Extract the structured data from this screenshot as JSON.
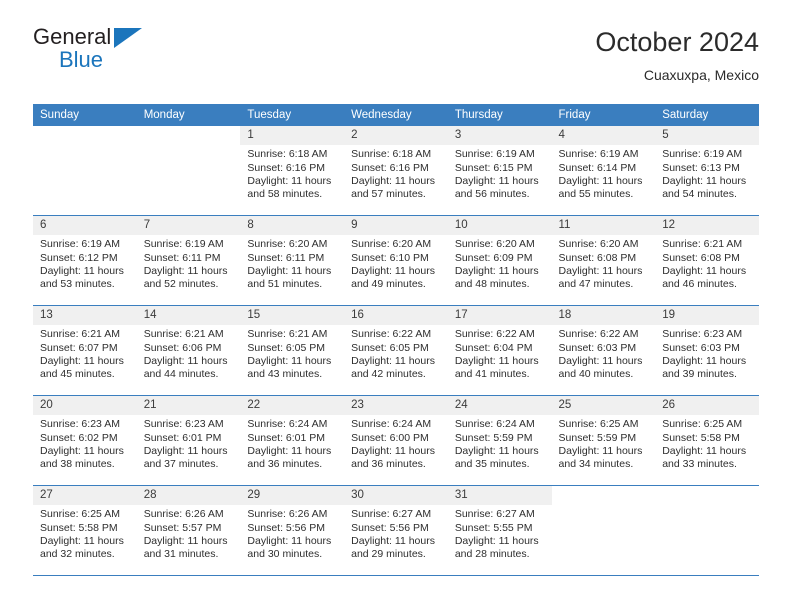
{
  "logo": {
    "word1": "General",
    "word2": "Blue",
    "accent": "#1b75bc",
    "triangle_icon": "triangle-icon"
  },
  "header": {
    "title": "October 2024",
    "location": "Cuaxuxpa, Mexico",
    "header_bg": "#3a7ebf"
  },
  "weekdays": [
    "Sunday",
    "Monday",
    "Tuesday",
    "Wednesday",
    "Thursday",
    "Friday",
    "Saturday"
  ],
  "labels": {
    "sunrise": "Sunrise:",
    "sunset": "Sunset:",
    "daylight": "Daylight:"
  },
  "weeks": [
    [
      {
        "day": "",
        "sunrise": "",
        "sunset": "",
        "daylight_l1": "",
        "daylight_l2": ""
      },
      {
        "day": "",
        "sunrise": "",
        "sunset": "",
        "daylight_l1": "",
        "daylight_l2": ""
      },
      {
        "day": "1",
        "sunrise": "Sunrise: 6:18 AM",
        "sunset": "Sunset: 6:16 PM",
        "daylight_l1": "Daylight: 11 hours",
        "daylight_l2": "and 58 minutes."
      },
      {
        "day": "2",
        "sunrise": "Sunrise: 6:18 AM",
        "sunset": "Sunset: 6:16 PM",
        "daylight_l1": "Daylight: 11 hours",
        "daylight_l2": "and 57 minutes."
      },
      {
        "day": "3",
        "sunrise": "Sunrise: 6:19 AM",
        "sunset": "Sunset: 6:15 PM",
        "daylight_l1": "Daylight: 11 hours",
        "daylight_l2": "and 56 minutes."
      },
      {
        "day": "4",
        "sunrise": "Sunrise: 6:19 AM",
        "sunset": "Sunset: 6:14 PM",
        "daylight_l1": "Daylight: 11 hours",
        "daylight_l2": "and 55 minutes."
      },
      {
        "day": "5",
        "sunrise": "Sunrise: 6:19 AM",
        "sunset": "Sunset: 6:13 PM",
        "daylight_l1": "Daylight: 11 hours",
        "daylight_l2": "and 54 minutes."
      }
    ],
    [
      {
        "day": "6",
        "sunrise": "Sunrise: 6:19 AM",
        "sunset": "Sunset: 6:12 PM",
        "daylight_l1": "Daylight: 11 hours",
        "daylight_l2": "and 53 minutes."
      },
      {
        "day": "7",
        "sunrise": "Sunrise: 6:19 AM",
        "sunset": "Sunset: 6:11 PM",
        "daylight_l1": "Daylight: 11 hours",
        "daylight_l2": "and 52 minutes."
      },
      {
        "day": "8",
        "sunrise": "Sunrise: 6:20 AM",
        "sunset": "Sunset: 6:11 PM",
        "daylight_l1": "Daylight: 11 hours",
        "daylight_l2": "and 51 minutes."
      },
      {
        "day": "9",
        "sunrise": "Sunrise: 6:20 AM",
        "sunset": "Sunset: 6:10 PM",
        "daylight_l1": "Daylight: 11 hours",
        "daylight_l2": "and 49 minutes."
      },
      {
        "day": "10",
        "sunrise": "Sunrise: 6:20 AM",
        "sunset": "Sunset: 6:09 PM",
        "daylight_l1": "Daylight: 11 hours",
        "daylight_l2": "and 48 minutes."
      },
      {
        "day": "11",
        "sunrise": "Sunrise: 6:20 AM",
        "sunset": "Sunset: 6:08 PM",
        "daylight_l1": "Daylight: 11 hours",
        "daylight_l2": "and 47 minutes."
      },
      {
        "day": "12",
        "sunrise": "Sunrise: 6:21 AM",
        "sunset": "Sunset: 6:08 PM",
        "daylight_l1": "Daylight: 11 hours",
        "daylight_l2": "and 46 minutes."
      }
    ],
    [
      {
        "day": "13",
        "sunrise": "Sunrise: 6:21 AM",
        "sunset": "Sunset: 6:07 PM",
        "daylight_l1": "Daylight: 11 hours",
        "daylight_l2": "and 45 minutes."
      },
      {
        "day": "14",
        "sunrise": "Sunrise: 6:21 AM",
        "sunset": "Sunset: 6:06 PM",
        "daylight_l1": "Daylight: 11 hours",
        "daylight_l2": "and 44 minutes."
      },
      {
        "day": "15",
        "sunrise": "Sunrise: 6:21 AM",
        "sunset": "Sunset: 6:05 PM",
        "daylight_l1": "Daylight: 11 hours",
        "daylight_l2": "and 43 minutes."
      },
      {
        "day": "16",
        "sunrise": "Sunrise: 6:22 AM",
        "sunset": "Sunset: 6:05 PM",
        "daylight_l1": "Daylight: 11 hours",
        "daylight_l2": "and 42 minutes."
      },
      {
        "day": "17",
        "sunrise": "Sunrise: 6:22 AM",
        "sunset": "Sunset: 6:04 PM",
        "daylight_l1": "Daylight: 11 hours",
        "daylight_l2": "and 41 minutes."
      },
      {
        "day": "18",
        "sunrise": "Sunrise: 6:22 AM",
        "sunset": "Sunset: 6:03 PM",
        "daylight_l1": "Daylight: 11 hours",
        "daylight_l2": "and 40 minutes."
      },
      {
        "day": "19",
        "sunrise": "Sunrise: 6:23 AM",
        "sunset": "Sunset: 6:03 PM",
        "daylight_l1": "Daylight: 11 hours",
        "daylight_l2": "and 39 minutes."
      }
    ],
    [
      {
        "day": "20",
        "sunrise": "Sunrise: 6:23 AM",
        "sunset": "Sunset: 6:02 PM",
        "daylight_l1": "Daylight: 11 hours",
        "daylight_l2": "and 38 minutes."
      },
      {
        "day": "21",
        "sunrise": "Sunrise: 6:23 AM",
        "sunset": "Sunset: 6:01 PM",
        "daylight_l1": "Daylight: 11 hours",
        "daylight_l2": "and 37 minutes."
      },
      {
        "day": "22",
        "sunrise": "Sunrise: 6:24 AM",
        "sunset": "Sunset: 6:01 PM",
        "daylight_l1": "Daylight: 11 hours",
        "daylight_l2": "and 36 minutes."
      },
      {
        "day": "23",
        "sunrise": "Sunrise: 6:24 AM",
        "sunset": "Sunset: 6:00 PM",
        "daylight_l1": "Daylight: 11 hours",
        "daylight_l2": "and 36 minutes."
      },
      {
        "day": "24",
        "sunrise": "Sunrise: 6:24 AM",
        "sunset": "Sunset: 5:59 PM",
        "daylight_l1": "Daylight: 11 hours",
        "daylight_l2": "and 35 minutes."
      },
      {
        "day": "25",
        "sunrise": "Sunrise: 6:25 AM",
        "sunset": "Sunset: 5:59 PM",
        "daylight_l1": "Daylight: 11 hours",
        "daylight_l2": "and 34 minutes."
      },
      {
        "day": "26",
        "sunrise": "Sunrise: 6:25 AM",
        "sunset": "Sunset: 5:58 PM",
        "daylight_l1": "Daylight: 11 hours",
        "daylight_l2": "and 33 minutes."
      }
    ],
    [
      {
        "day": "27",
        "sunrise": "Sunrise: 6:25 AM",
        "sunset": "Sunset: 5:58 PM",
        "daylight_l1": "Daylight: 11 hours",
        "daylight_l2": "and 32 minutes."
      },
      {
        "day": "28",
        "sunrise": "Sunrise: 6:26 AM",
        "sunset": "Sunset: 5:57 PM",
        "daylight_l1": "Daylight: 11 hours",
        "daylight_l2": "and 31 minutes."
      },
      {
        "day": "29",
        "sunrise": "Sunrise: 6:26 AM",
        "sunset": "Sunset: 5:56 PM",
        "daylight_l1": "Daylight: 11 hours",
        "daylight_l2": "and 30 minutes."
      },
      {
        "day": "30",
        "sunrise": "Sunrise: 6:27 AM",
        "sunset": "Sunset: 5:56 PM",
        "daylight_l1": "Daylight: 11 hours",
        "daylight_l2": "and 29 minutes."
      },
      {
        "day": "31",
        "sunrise": "Sunrise: 6:27 AM",
        "sunset": "Sunset: 5:55 PM",
        "daylight_l1": "Daylight: 11 hours",
        "daylight_l2": "and 28 minutes."
      },
      {
        "day": "",
        "sunrise": "",
        "sunset": "",
        "daylight_l1": "",
        "daylight_l2": ""
      },
      {
        "day": "",
        "sunrise": "",
        "sunset": "",
        "daylight_l1": "",
        "daylight_l2": ""
      }
    ]
  ]
}
